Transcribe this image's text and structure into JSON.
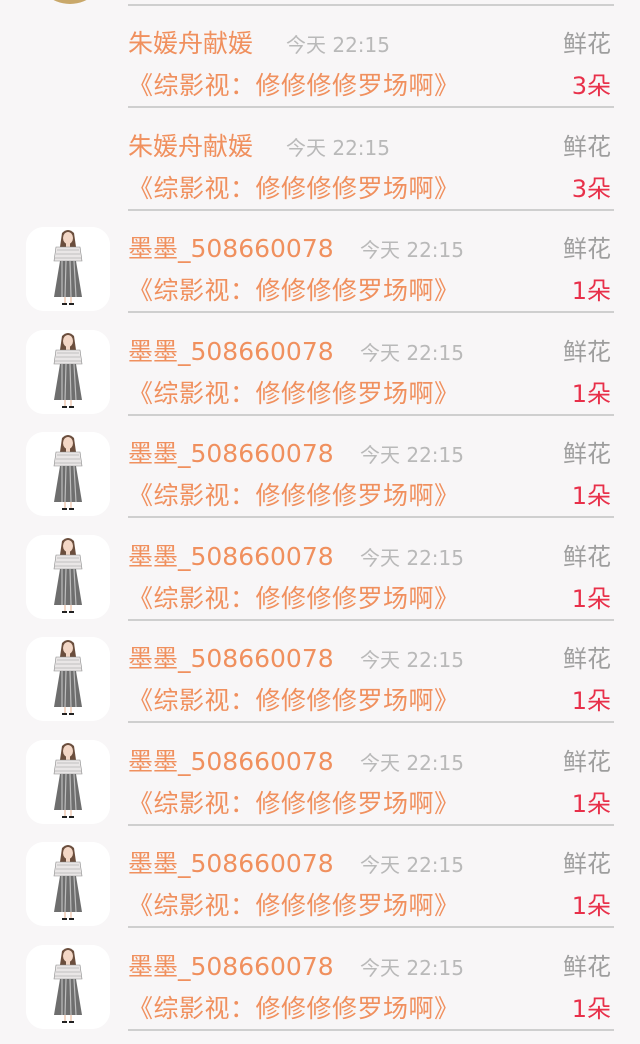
{
  "colors": {
    "name": "#f0905e",
    "time": "#b9b9b9",
    "gift": "#9e9e9e",
    "count": "#e8304a",
    "divider": "#cfcfcf",
    "background": "#f8f6f7"
  },
  "rows": [
    {
      "name": "朱媛舟献媛",
      "time": "今天 22:15",
      "gift": "鲜花",
      "book": "《综影视：修修修修罗场啊》",
      "count": "3朵",
      "avatar": "none"
    },
    {
      "name": "朱媛舟献媛",
      "time": "今天 22:15",
      "gift": "鲜花",
      "book": "《综影视：修修修修罗场啊》",
      "count": "3朵",
      "avatar": "none"
    },
    {
      "name": "墨墨_508660078",
      "time": "今天 22:15",
      "gift": "鲜花",
      "book": "《综影视：修修修修罗场啊》",
      "count": "1朵",
      "avatar": "girl-in-dress"
    },
    {
      "name": "墨墨_508660078",
      "time": "今天 22:15",
      "gift": "鲜花",
      "book": "《综影视：修修修修罗场啊》",
      "count": "1朵",
      "avatar": "girl-in-dress"
    },
    {
      "name": "墨墨_508660078",
      "time": "今天 22:15",
      "gift": "鲜花",
      "book": "《综影视：修修修修罗场啊》",
      "count": "1朵",
      "avatar": "girl-in-dress"
    },
    {
      "name": "墨墨_508660078",
      "time": "今天 22:15",
      "gift": "鲜花",
      "book": "《综影视：修修修修罗场啊》",
      "count": "1朵",
      "avatar": "girl-in-dress"
    },
    {
      "name": "墨墨_508660078",
      "time": "今天 22:15",
      "gift": "鲜花",
      "book": "《综影视：修修修修罗场啊》",
      "count": "1朵",
      "avatar": "girl-in-dress"
    },
    {
      "name": "墨墨_508660078",
      "time": "今天 22:15",
      "gift": "鲜花",
      "book": "《综影视：修修修修罗场啊》",
      "count": "1朵",
      "avatar": "girl-in-dress"
    },
    {
      "name": "墨墨_508660078",
      "time": "今天 22:15",
      "gift": "鲜花",
      "book": "《综影视：修修修修罗场啊》",
      "count": "1朵",
      "avatar": "girl-in-dress"
    },
    {
      "name": "墨墨_508660078",
      "time": "今天 22:15",
      "gift": "鲜花",
      "book": "《综影视：修修修修罗场啊》",
      "count": "1朵",
      "avatar": "girl-in-dress"
    }
  ]
}
